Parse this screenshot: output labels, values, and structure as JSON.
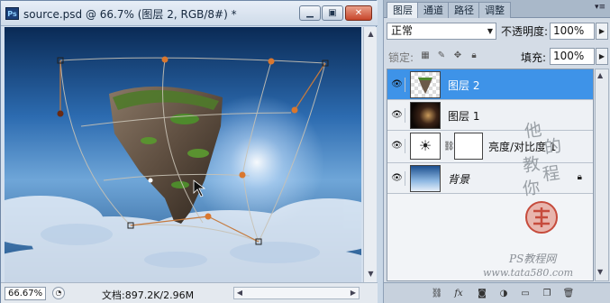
{
  "colors": {
    "accent": "#3e93e8",
    "selected_layer_text": "#ffffff"
  },
  "document": {
    "title": "source.psd @ 66.7% (图层 2, RGB/8#) *",
    "app_icon": "Ps",
    "minimize_icon": "minimize-icon",
    "maximize_icon": "maximize-icon",
    "close_icon": "close-icon",
    "zoom": "66.67%",
    "doc_info": "文档:897.2K/2.96M"
  },
  "panel": {
    "tabs": [
      "图层",
      "通道",
      "路径",
      "调整"
    ],
    "blend_mode": "正常",
    "opacity_label": "不透明度:",
    "opacity_value": "100%",
    "lock_label": "锁定:",
    "fill_label": "填充:",
    "fill_value": "100%",
    "layers": [
      {
        "name": "图层 2",
        "selected": true
      },
      {
        "name": "图层 1",
        "selected": false
      },
      {
        "name": "亮度/对比度 1",
        "selected": false
      },
      {
        "name": "背景",
        "selected": false,
        "locked": true
      }
    ],
    "bottom_icons": [
      "link-icon",
      "fx-icon",
      "mask-icon",
      "adjustment-icon",
      "folder-icon",
      "new-layer-icon",
      "trash-icon"
    ]
  },
  "watermark": {
    "chars": [
      "他",
      "的",
      "教",
      "程",
      "你"
    ],
    "site": "PS教程网",
    "url": "www.tata580.com"
  }
}
